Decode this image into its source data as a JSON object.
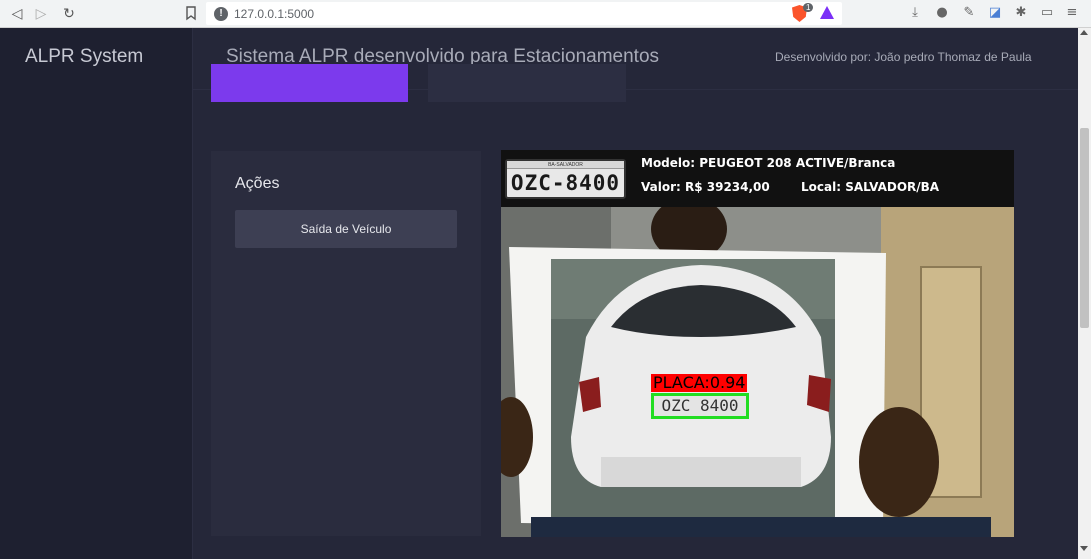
{
  "browser": {
    "url": "127.0.0.1:5000",
    "shield_count": "1"
  },
  "sidebar": {
    "brand": "ALPR System"
  },
  "topbar": {
    "title": "Sistema ALPR desenvolvido para Estacionamentos",
    "developer": "Desenvolvido por: João pedro Thomaz de Paula"
  },
  "actions": {
    "title": "Ações",
    "exit_button": "Saída de Veículo"
  },
  "result": {
    "plate_number": "OZC-8400",
    "plate_city": "BA-SALVADOR",
    "model": "Modelo: PEUGEOT 208 ACTIVE/Branca",
    "value": "Valor: R$ 39234,00",
    "location": "Local: SALVADOR/BA",
    "detection_label": "PLACA:0.94",
    "detected_plate": "OZC 8400"
  },
  "colors": {
    "accent": "#7c3aed",
    "detection_box": "#22dd22",
    "detection_label_bg": "#ff0000"
  }
}
